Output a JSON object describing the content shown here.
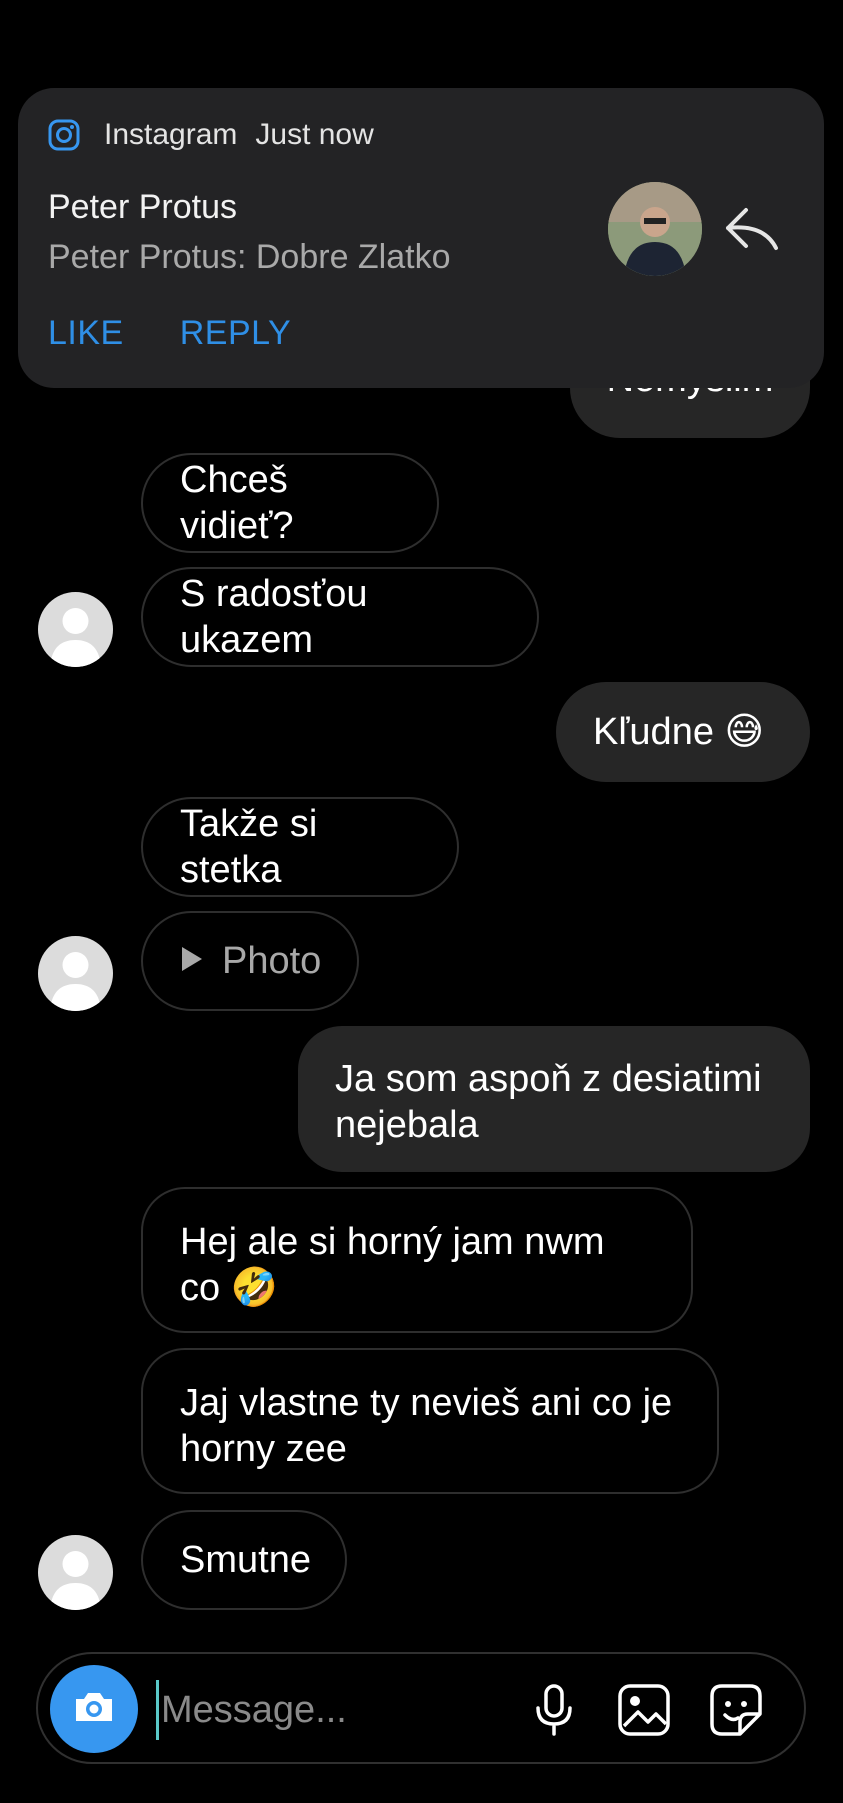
{
  "notification": {
    "app_name": "Instagram",
    "time": "Just now",
    "title": "Peter Protus",
    "body": "Peter Protus: Dobre Zlatko",
    "actions": {
      "like": "LIKE",
      "reply": "REPLY"
    }
  },
  "messages": [
    {
      "side": "out",
      "text": "Nemyslim"
    },
    {
      "side": "in",
      "text": "Chceš vidieť?"
    },
    {
      "side": "in",
      "text": "S radosťou ukazem"
    },
    {
      "side": "out",
      "text": "Kľudne 😅"
    },
    {
      "side": "in",
      "text": "Takže si stetka"
    },
    {
      "side": "in",
      "text": "Photo",
      "type": "photo"
    },
    {
      "side": "out",
      "text": "Ja som aspoň z desiatimi nejebala"
    },
    {
      "side": "in",
      "text": "Hej ale si horný jam nwm co 🤣"
    },
    {
      "side": "in",
      "text": "Jaj vlastne ty nevieš ani co je horny zee"
    },
    {
      "side": "in",
      "text": "Smutne"
    }
  ],
  "composer": {
    "placeholder": "Message..."
  },
  "icons": {
    "notification_app": "instagram-icon",
    "notification_reply": "reply-icon",
    "camera": "camera-icon",
    "mic": "microphone-icon",
    "gallery": "gallery-icon",
    "sticker": "sticker-icon"
  },
  "colors": {
    "accent": "#3797f0",
    "notification_action": "#2f8fe6",
    "outgoing_bubble": "#262626",
    "background": "#000000"
  }
}
